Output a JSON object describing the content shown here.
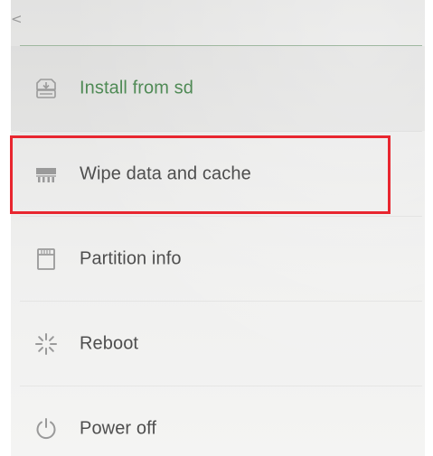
{
  "header": {
    "back_glyph": "<"
  },
  "menu": {
    "items": [
      {
        "label": "Install from sd",
        "icon": "install-sd-icon",
        "state": "active"
      },
      {
        "label": "Wipe data and cache",
        "icon": "wipe-drive-icon",
        "state": "normal"
      },
      {
        "label": "Partition info",
        "icon": "sd-card-icon",
        "state": "normal"
      },
      {
        "label": "Reboot",
        "icon": "reboot-spinner-icon",
        "state": "normal"
      },
      {
        "label": "Power off",
        "icon": "power-icon",
        "state": "normal"
      }
    ]
  },
  "colors": {
    "accent_text": "#4f8a55",
    "normal_text": "#4e4e4e",
    "icon_gray": "#9a9a9a",
    "header_divider": "#9fb8a0",
    "highlight_box": "#e8262f"
  }
}
